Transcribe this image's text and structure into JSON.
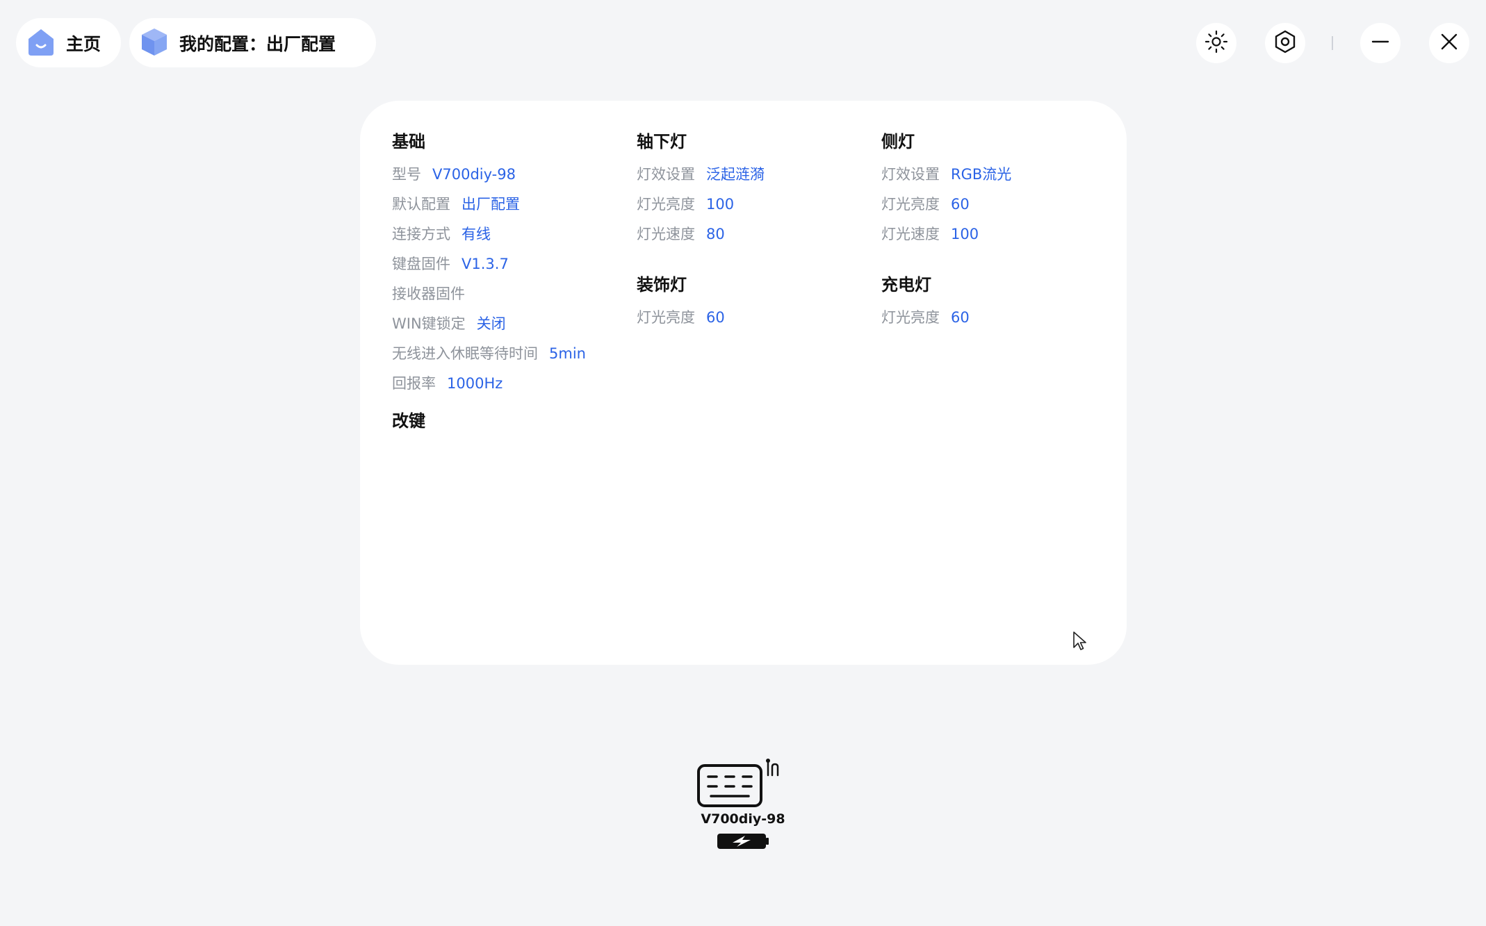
{
  "header": {
    "home_label": "主页",
    "config_label": "我的配置：出厂配置"
  },
  "window_controls": {
    "theme_icon": "sun-icon",
    "settings_icon": "hexagon-gear-icon",
    "minimize_icon": "minus-icon",
    "close_icon": "close-icon"
  },
  "config": {
    "basic": {
      "title": "基础",
      "items": [
        {
          "label": "型号",
          "value": "V700diy-98"
        },
        {
          "label": "默认配置",
          "value": "出厂配置"
        },
        {
          "label": "连接方式",
          "value": "有线"
        },
        {
          "label": "键盘固件",
          "value": "V1.3.7"
        },
        {
          "label": "接收器固件",
          "value": ""
        },
        {
          "label": "WIN键锁定",
          "value": "关闭"
        },
        {
          "label": "无线进入休眠等待时间",
          "value": "5min"
        },
        {
          "label": "回报率",
          "value": "1000Hz"
        }
      ]
    },
    "remap": {
      "title": "改键"
    },
    "under_light": {
      "title": "轴下灯",
      "items": [
        {
          "label": "灯效设置",
          "value": "泛起涟漪"
        },
        {
          "label": "灯光亮度",
          "value": "100"
        },
        {
          "label": "灯光速度",
          "value": "80"
        }
      ]
    },
    "decor_light": {
      "title": "装饰灯",
      "items": [
        {
          "label": "灯光亮度",
          "value": "60"
        }
      ]
    },
    "side_light": {
      "title": "侧灯",
      "items": [
        {
          "label": "灯效设置",
          "value": "RGB流光"
        },
        {
          "label": "灯光亮度",
          "value": "60"
        },
        {
          "label": "灯光速度",
          "value": "100"
        }
      ]
    },
    "charge_light": {
      "title": "充电灯",
      "items": [
        {
          "label": "灯光亮度",
          "value": "60"
        }
      ]
    }
  },
  "device": {
    "name": "V700diy-98",
    "icon": "keyboard-wired-icon",
    "battery_icon": "battery-charging-icon"
  },
  "colors": {
    "accent": "#2b63e6",
    "home_icon": "#7fa0f4",
    "muted_label": "#8e939b"
  }
}
